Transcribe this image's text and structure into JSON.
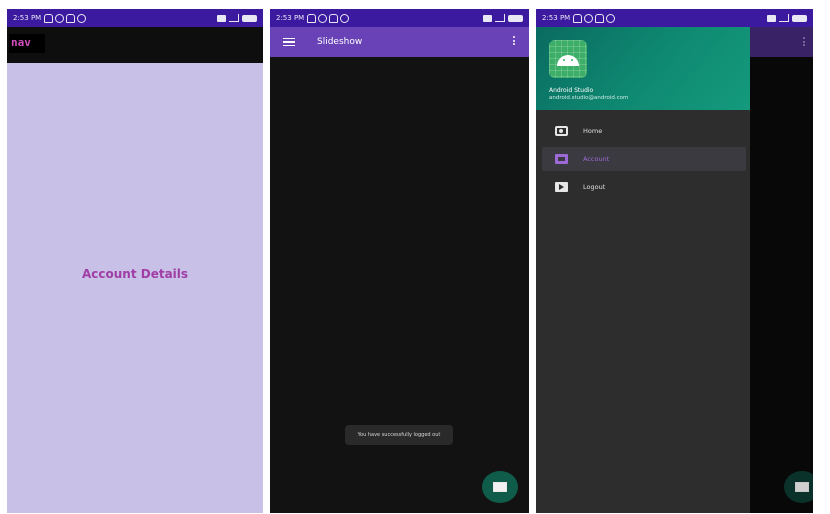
{
  "status_bar": {
    "time": "2:53 PM"
  },
  "screen1": {
    "nav_label": "nav",
    "content_text": "Account Details",
    "background_color": "#c8c0e6"
  },
  "screen2": {
    "title": "Slideshow",
    "toast": "You have successfully logged out",
    "fab_icon": "mail-icon",
    "appbar_color": "#6a42b8"
  },
  "screen3": {
    "header": {
      "name": "Android Studio",
      "email": "android.studio@android.com"
    },
    "menu": [
      {
        "label": "Home",
        "icon": "camera-icon"
      },
      {
        "label": "Account",
        "icon": "gallery-icon",
        "selected": true
      },
      {
        "label": "Logout",
        "icon": "slideshow-icon"
      }
    ],
    "accent_color": "#9b6ad6"
  }
}
